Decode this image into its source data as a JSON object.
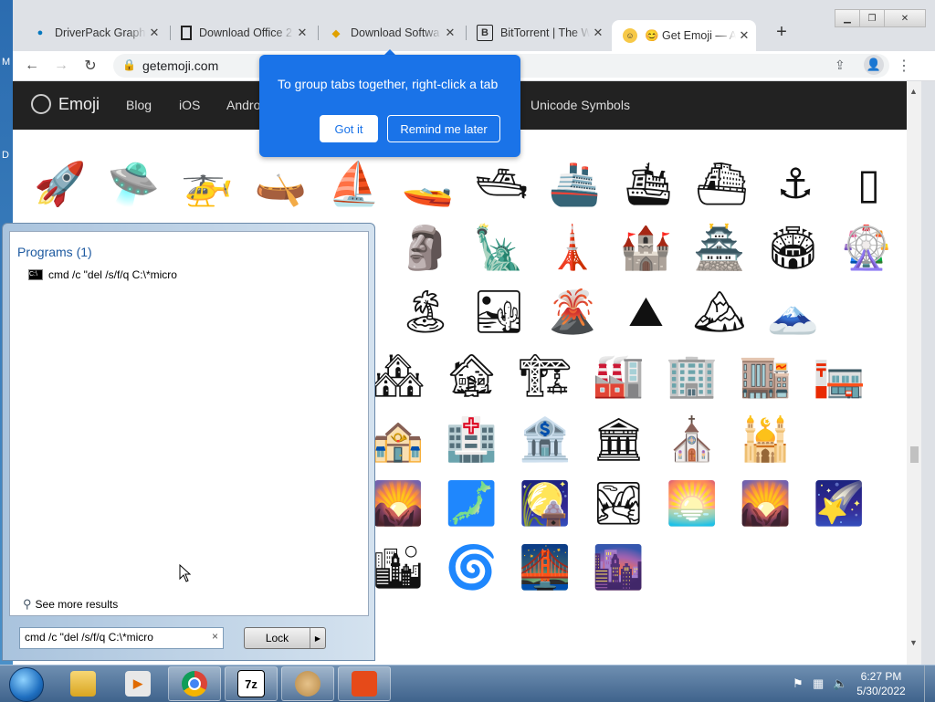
{
  "desktop": {
    "left_chars": [
      "M",
      "D"
    ]
  },
  "browser": {
    "tabs": [
      {
        "title": "DriverPack Graphi",
        "icon": "drupal-icon",
        "active": false
      },
      {
        "title": "Download Office 2",
        "icon": "document-icon",
        "active": false
      },
      {
        "title": "Download Softwa",
        "icon": "tag-icon",
        "active": false
      },
      {
        "title": "BitTorrent | The W",
        "icon": "bittorrent-icon",
        "active": false
      },
      {
        "title": "😊 Get Emoji — Al",
        "icon": "smiley-icon",
        "active": true
      }
    ],
    "new_tab": "+",
    "url": "getemoji.com"
  },
  "popup": {
    "text": "To group tabs together, right-click a tab",
    "got_it": "Got it",
    "remind_later": "Remind me later"
  },
  "site": {
    "logo": "Emoji",
    "nav": [
      "Blog",
      "iOS",
      "Andro",
      "Unicode Symbols"
    ]
  },
  "emoji_rows": [
    [
      "🚀",
      "🛸",
      "🚁",
      "🛶",
      "⛵",
      "🚤",
      "🛥",
      "🚢",
      "🛳",
      "⛴",
      "⚓",
      "▯"
    ],
    [
      "🗿",
      "🗽",
      "🗼",
      "🏰",
      "🏯",
      "🏟",
      "🎡"
    ],
    [
      "🏝",
      "🏜",
      "🌋",
      "⛰",
      "🏔",
      "🗻"
    ],
    [
      "🏘",
      "🏚",
      "🏗",
      "🏭",
      "🏢",
      "🏬",
      "🏣"
    ],
    [
      "🏤",
      "🏥",
      "🏦",
      "🏛",
      "⛪",
      "🕌"
    ],
    [
      "🌄",
      "🗾",
      "🎑",
      "🏞",
      "🌅",
      "🌄",
      "🌠"
    ],
    [
      "🏙",
      "🌀",
      "🌉",
      "🌆"
    ]
  ],
  "start_menu": {
    "programs_heading": "Programs (1)",
    "program_item": "cmd /c \"del /s/f/q C:\\*micro",
    "see_more": "See more results",
    "search_value": "cmd /c \"del /s/f/q C:\\*micro",
    "clear": "×",
    "lock_label": "Lock"
  },
  "taskbar": {
    "apps": [
      {
        "name": "explorer",
        "label": ""
      },
      {
        "name": "media-player",
        "label": ""
      },
      {
        "name": "chrome",
        "label": ""
      },
      {
        "name": "7zip",
        "label": "7z"
      },
      {
        "name": "paint",
        "label": ""
      },
      {
        "name": "office",
        "label": ""
      }
    ],
    "time": "6:27 PM",
    "date": "5/30/2022"
  }
}
